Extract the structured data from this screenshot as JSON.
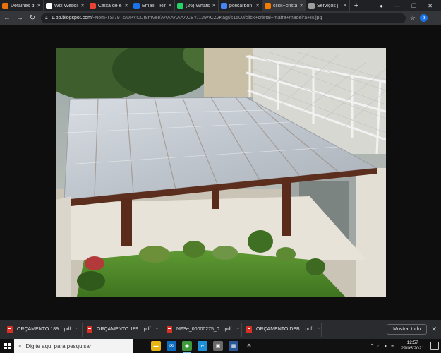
{
  "tabs": [
    {
      "label": "Detalhes d",
      "icon": "pdf-doc-icon",
      "color": "#e8710a",
      "active": false
    },
    {
      "label": "Wix Websit",
      "icon": "wix-icon",
      "color": "#ffffff",
      "active": false
    },
    {
      "label": "Caixa de e",
      "icon": "gmail-icon",
      "color": "#ea4335",
      "active": false
    },
    {
      "label": "Email – Rin",
      "icon": "outlook-icon",
      "color": "#1a73e8",
      "active": false
    },
    {
      "label": "(26) Whats",
      "icon": "whatsapp-icon",
      "color": "#25d366",
      "active": false
    },
    {
      "label": "policarbon",
      "icon": "google-icon",
      "color": "#4285f4",
      "active": false
    },
    {
      "label": "click+crista",
      "icon": "blogger-icon",
      "color": "#f57c00",
      "active": true
    },
    {
      "label": "Serviços | ",
      "icon": "page-icon",
      "color": "#9e9e9e",
      "active": false
    }
  ],
  "toolbar": {
    "url_host": "1.bp.blogspot.com",
    "url_path": "/-Nom-TSi79_s/UPYCUr8mVeI/AAAAAAAACBY/139ACZvKagI/s1600/click+cristal+mafra+madeira+III.jpg",
    "profile_initial": "d"
  },
  "downloads": [
    {
      "name": "ORÇAMENTO 189....pdf"
    },
    {
      "name": "ORÇAMENTO 189....pdf"
    },
    {
      "name": "NFSe_00000275_0....pdf"
    },
    {
      "name": "ORÇAMENTO DEB....pdf"
    }
  ],
  "downloads_bar": {
    "show_all": "Mostrar tudo"
  },
  "taskbar": {
    "search_placeholder": "Digite aqui para pesquisar",
    "time": "12:57",
    "date": "29/05/2021"
  },
  "photo": {
    "subject": "polycarbonate-roof-pergola-image"
  }
}
